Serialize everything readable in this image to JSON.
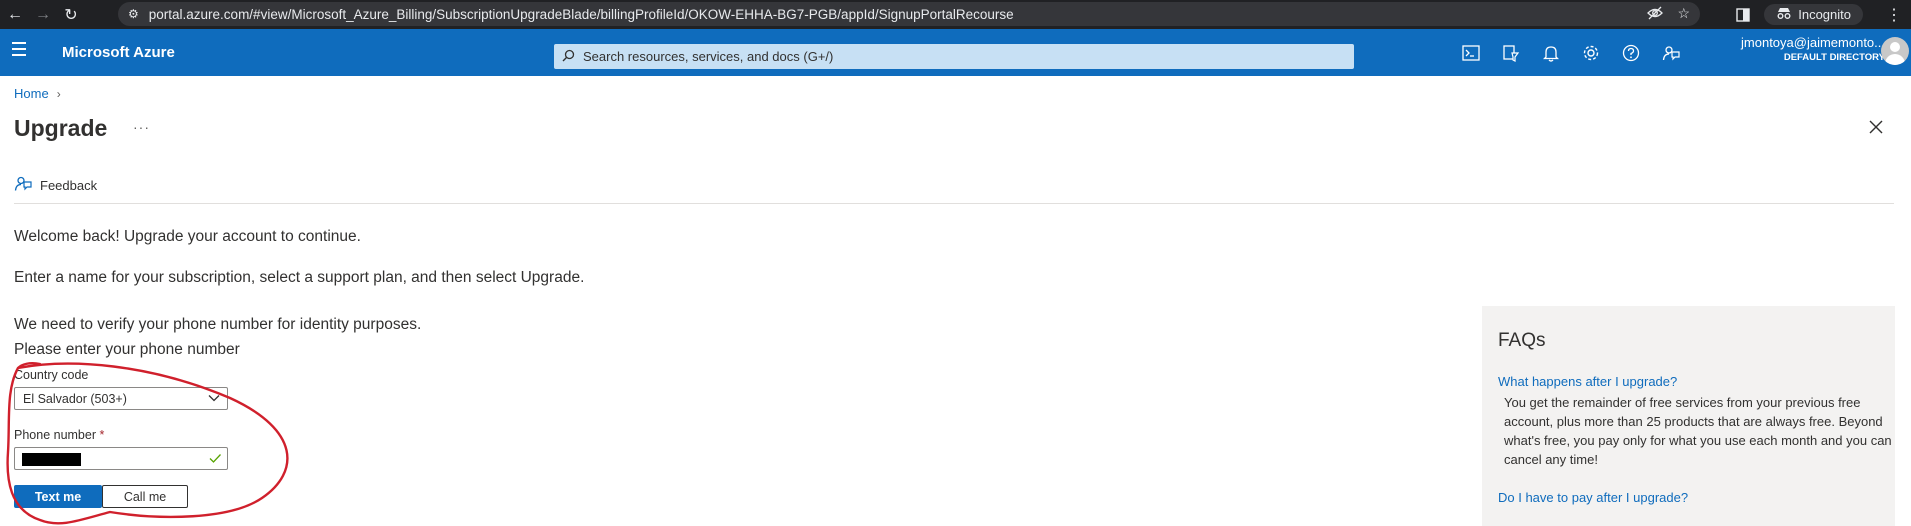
{
  "browser": {
    "url": "portal.azure.com/#view/Microsoft_Azure_Billing/SubscriptionUpgradeBlade/billingProfileId/OKOW-EHHA-BG7-PGB/appId/SignupPortalRecourse",
    "incognito_label": "Incognito"
  },
  "azure": {
    "brand": "Microsoft Azure",
    "search_placeholder": "Search resources, services, and docs (G+/)",
    "user_name": "jmontoya@jaimemonto...",
    "user_directory": "DEFAULT DIRECTORY"
  },
  "breadcrumb": {
    "home": "Home"
  },
  "page": {
    "title": "Upgrade",
    "more": "···",
    "feedback": "Feedback"
  },
  "content": {
    "welcome": "Welcome back! Upgrade your account to continue.",
    "instructions": "Enter a name for your subscription, select a support plan, and then select Upgrade.",
    "verify": "We need to verify your phone number for identity purposes.",
    "enter_phone": "Please enter your phone number",
    "country_label": "Country code",
    "country_value": "El Salvador (503+)",
    "phone_label": "Phone number",
    "required_mark": "*",
    "text_me": "Text me",
    "call_me": "Call me"
  },
  "faq": {
    "title": "FAQs",
    "q1": "What happens after I upgrade?",
    "a1": "You get the remainder of free services from your previous free account, plus more than 25 products that are always free. Beyond what's free, you pay only for what you use each month and you can cancel any time!",
    "q2": "Do I have to pay after I upgrade?"
  },
  "colors": {
    "azure_blue": "#0f6cbd",
    "annotation_red": "#d0202c"
  }
}
